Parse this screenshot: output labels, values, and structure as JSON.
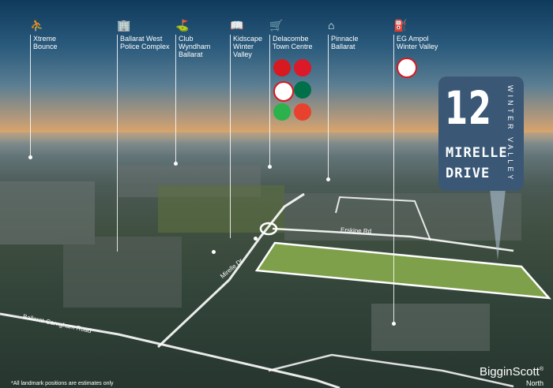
{
  "landmarks": [
    {
      "name": "Xtreme\nBounce",
      "icon": "trampoline-icon",
      "glyph": "⛹"
    },
    {
      "name": "Ballarat West\nPolice Complex",
      "icon": "police-building-icon",
      "glyph": "🏢"
    },
    {
      "name": "Club\nWyndham\nBallarat",
      "icon": "clubhouse-icon",
      "glyph": "⛳"
    },
    {
      "name": "Kidscape\nWinter\nValley",
      "icon": "book-icon",
      "glyph": "📖"
    },
    {
      "name": "Delacombe\nTown Centre",
      "icon": "shopping-cart-icon",
      "glyph": "🛒"
    },
    {
      "name": "Pinnacle\nBallarat",
      "icon": "house-icon",
      "glyph": "⌂"
    },
    {
      "name": "EG Ampol\nWinter Valley",
      "icon": "fuel-pump-icon",
      "glyph": "⛽"
    }
  ],
  "brand_logos": [
    {
      "icon": "kmart-logo-icon",
      "color": "#d71920"
    },
    {
      "icon": "australia-post-logo-icon",
      "color": "#dc1928"
    },
    {
      "icon": "seven-eleven-logo-icon",
      "color": "#ffffff"
    },
    {
      "icon": "starbucks-logo-icon",
      "color": "#00704a"
    },
    {
      "icon": "woolworths-logo-icon",
      "color": "#2bb24c"
    },
    {
      "icon": "hungry-jacks-logo-icon",
      "color": "#e8422f"
    },
    {
      "icon": "ampol-logo-icon",
      "color": "#ffffff"
    }
  ],
  "badge": {
    "number": "12",
    "street_line1": "MIRELLE",
    "street_line2": "DRIVE",
    "area": "WINTER VALLEY",
    "color": "#3a5876"
  },
  "roads": {
    "erskine": "Erskine Rd",
    "mirelle": "Mirelle Dr",
    "carngham": "Ballarat-Carngham Road"
  },
  "disclaimer": "*All landmark positions are estimates only",
  "brand": {
    "name": "BigginScott",
    "mark": "®",
    "region": "North"
  },
  "colors": {
    "lot_fill": "#7fa04a",
    "lot_outline": "#ffffff",
    "sky_top": "#0f3a5c",
    "horizon": "#d9a46b"
  }
}
